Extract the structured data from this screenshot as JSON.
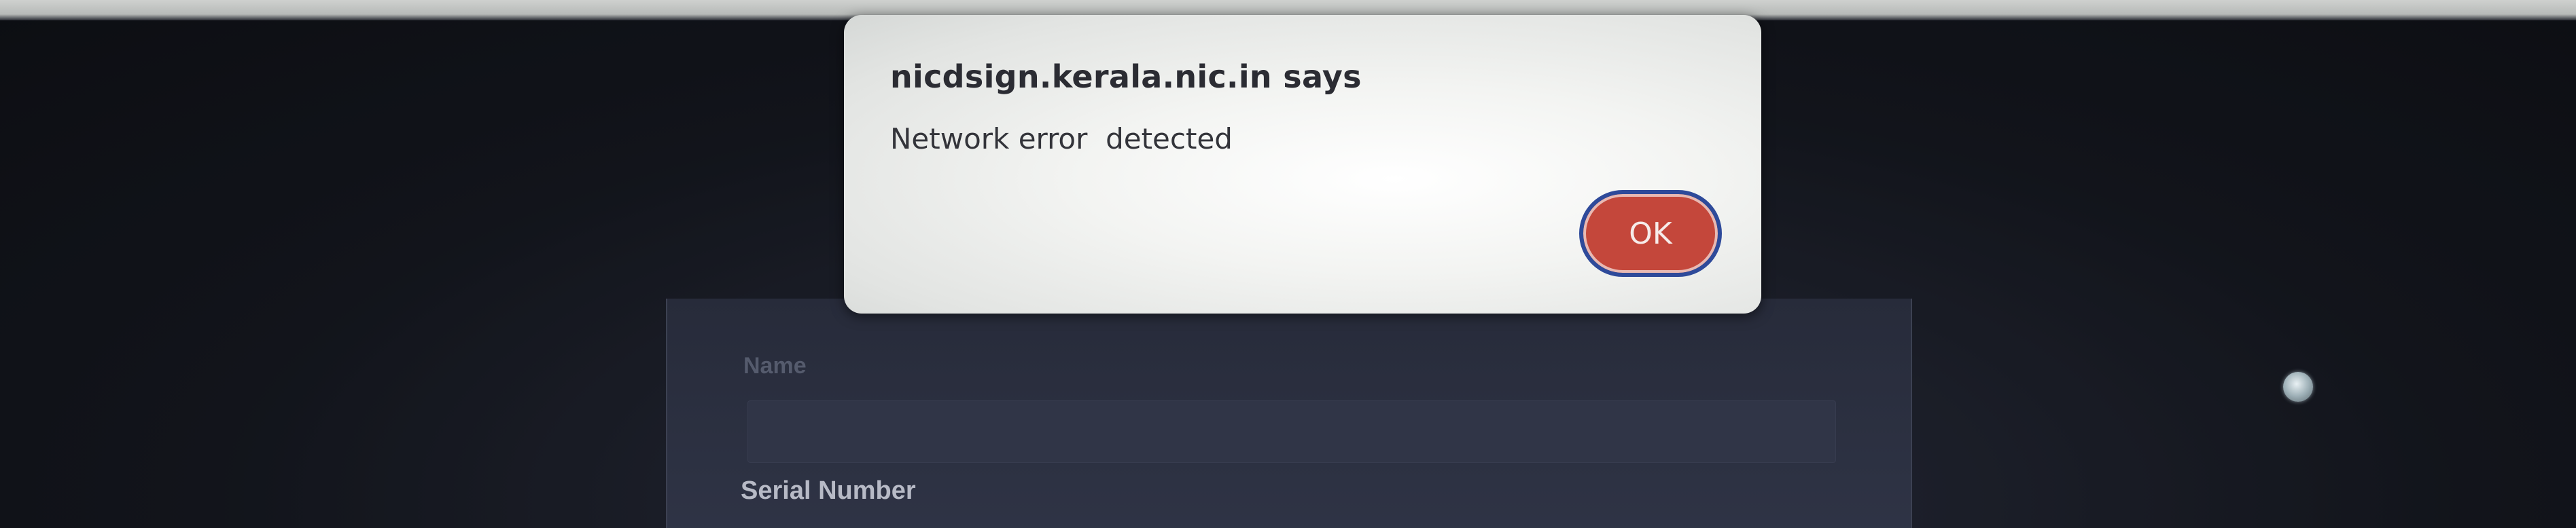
{
  "alert_dialog": {
    "title": "nicdsign.kerala.nic.in says",
    "message": "Network error  detected",
    "ok_label": "OK"
  },
  "background_form": {
    "name_label": "Name",
    "serial_label": "Serial Number"
  },
  "colors": {
    "ok_button": "#c4473b",
    "ok_focus_ring": "#2e4a9a",
    "dialog_background": "#f0f1ef",
    "page_background": "#181b24"
  }
}
